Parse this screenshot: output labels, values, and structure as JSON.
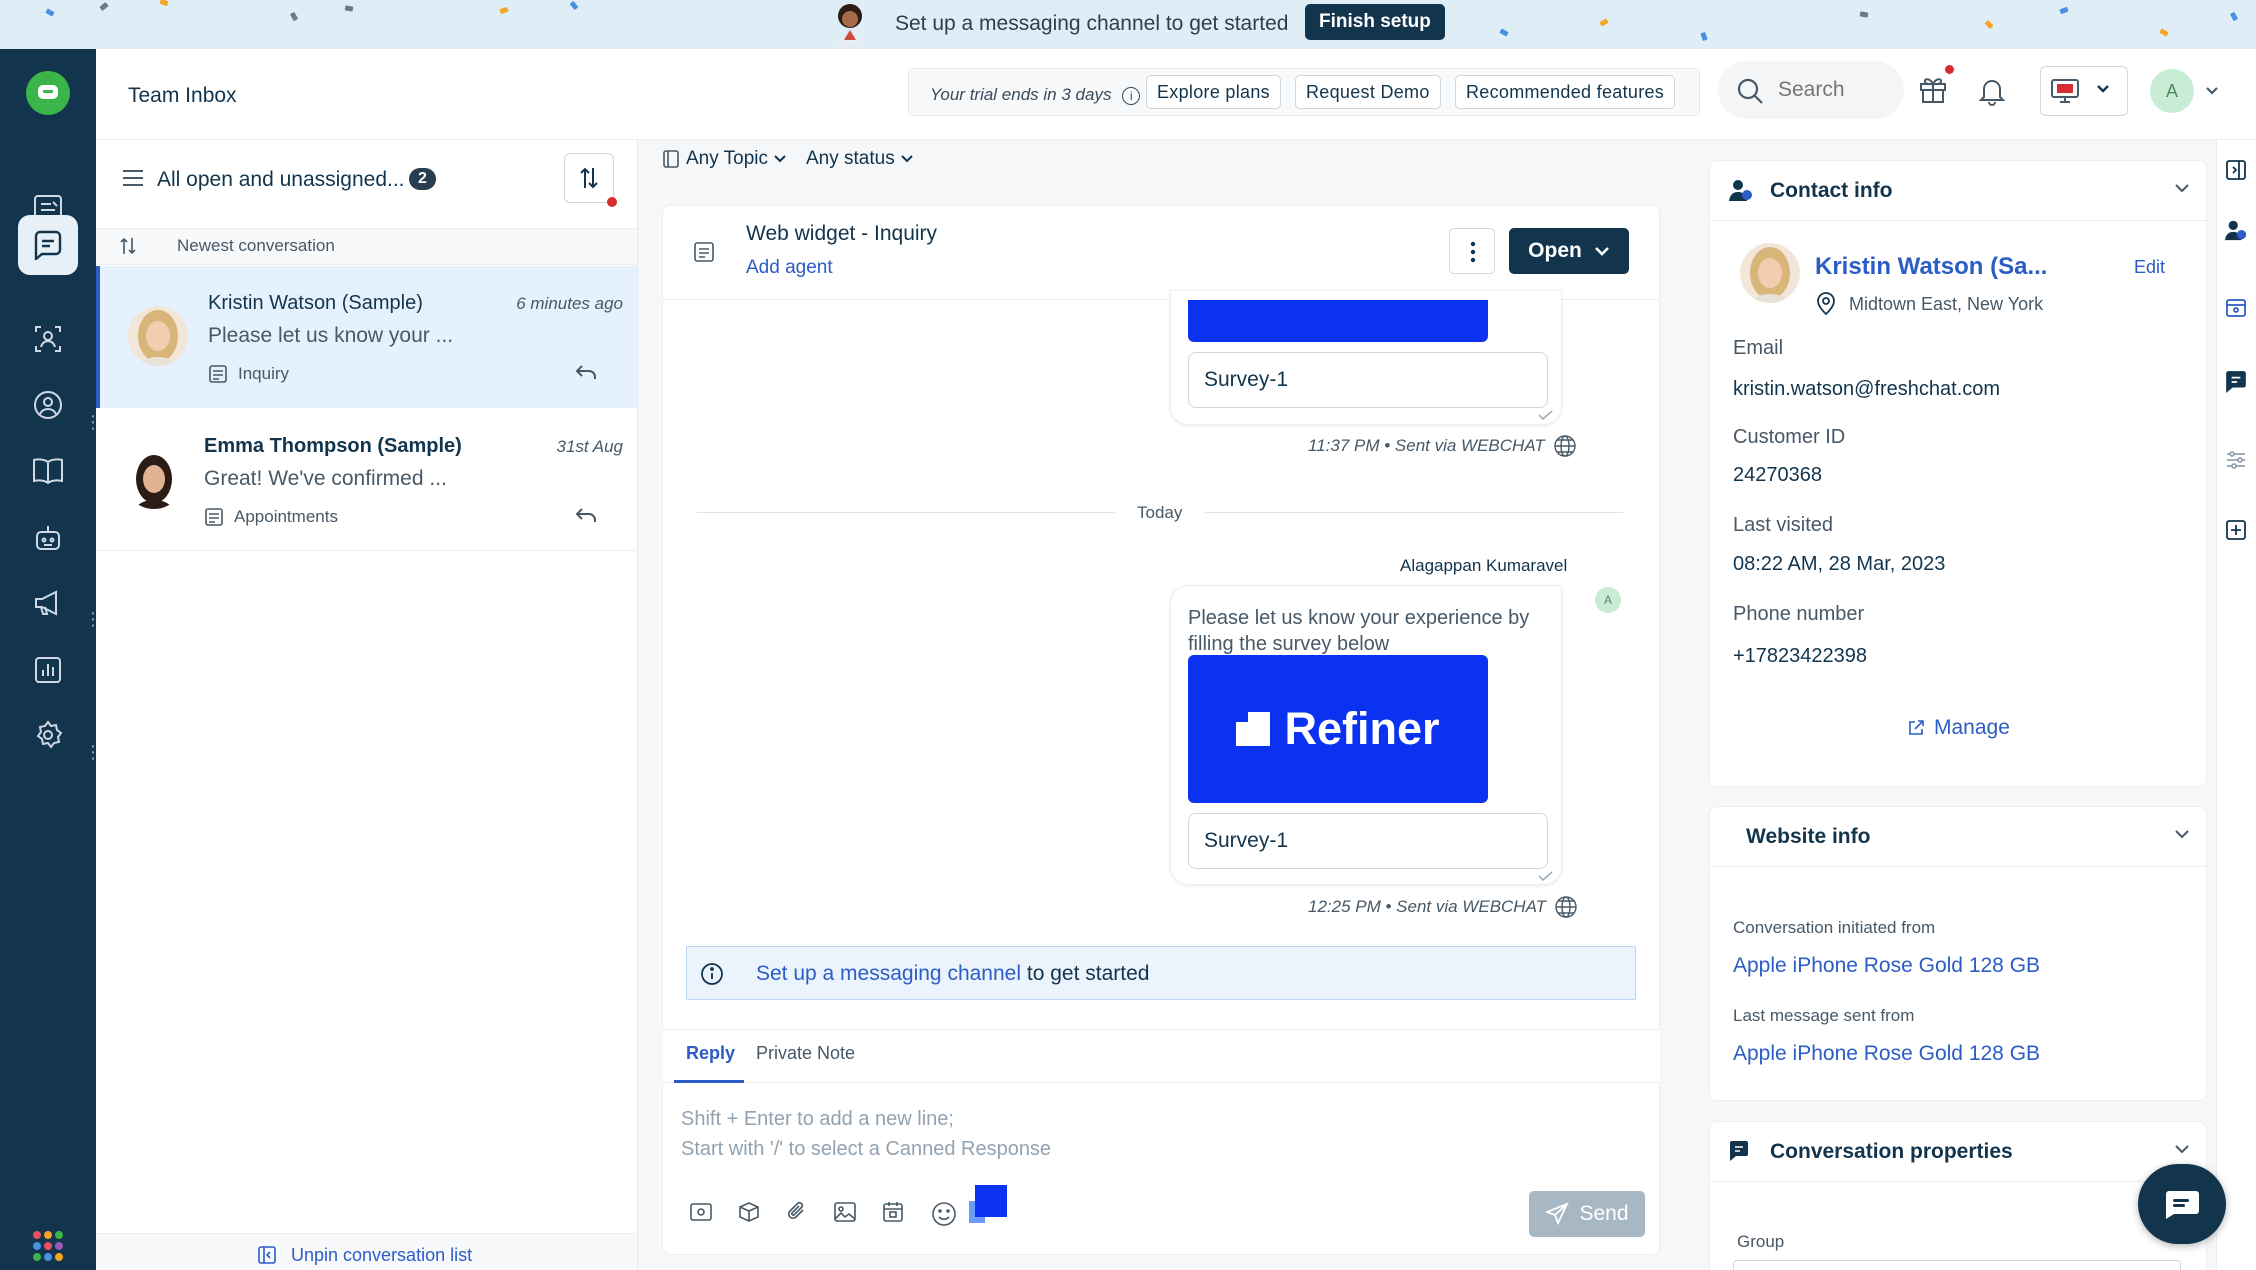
{
  "banner": {
    "text": "Set up a messaging channel to get started",
    "button": "Finish setup"
  },
  "header": {
    "title": "Team Inbox",
    "trial_text": "Your trial ends in 3 days",
    "buttons": [
      "Explore plans",
      "Request Demo",
      "Recommended features"
    ],
    "search_placeholder": "Search",
    "avatar_initial": "A"
  },
  "conv_list": {
    "title": "All open and unassigned...",
    "count": "2",
    "sort_label": "Newest conversation",
    "items": [
      {
        "name": "Kristin Watson (Sample)",
        "time": "6 minutes ago",
        "preview": "Please let us know your ...",
        "tag": "Inquiry",
        "active": true
      },
      {
        "name": "Emma Thompson (Sample)",
        "time": "31st Aug",
        "preview": "Great! We've confirmed ...",
        "tag": "Appointments",
        "active": false
      }
    ],
    "unpin_label": "Unpin conversation list"
  },
  "center": {
    "filters": {
      "topic": "Any Topic",
      "status": "Any status"
    },
    "conversation_title": "Web widget - Inquiry",
    "add_agent": "Add agent",
    "status_button": "Open",
    "messages": [
      {
        "survey_label": "Survey-1",
        "meta": "11:37 PM • Sent via WEBCHAT"
      },
      {
        "agent": "Alagappan Kumaravel",
        "agent_initial": "A",
        "text": "Please let us know your experience by filling the survey below",
        "card_brand": "Refiner",
        "survey_label": "Survey-1",
        "meta": "12:25 PM • Sent via WEBCHAT"
      }
    ],
    "date_divider": "Today",
    "setup_strip": {
      "link": "Set up a messaging channel",
      "rest": "to get started"
    },
    "compose": {
      "tabs": [
        "Reply",
        "Private Note"
      ],
      "placeholder_line1": "Shift + Enter to add a new line;",
      "placeholder_line2": "Start with '/' to select a Canned Response",
      "send": "Send"
    }
  },
  "contact": {
    "section_title": "Contact info",
    "name": "Kristin Watson (Sa...",
    "edit": "Edit",
    "location": "Midtown East, New York",
    "fields": [
      {
        "label": "Email",
        "value": "kristin.watson@freshchat.com"
      },
      {
        "label": "Customer ID",
        "value": "24270368"
      },
      {
        "label": "Last visited",
        "value": "08:22 AM, 28 Mar, 2023"
      },
      {
        "label": "Phone number",
        "value": "+17823422398"
      }
    ],
    "manage": "Manage"
  },
  "website_info": {
    "section_title": "Website info",
    "initiated_label": "Conversation initiated from",
    "initiated_value": "Apple iPhone Rose Gold 128 GB",
    "last_label": "Last message sent from",
    "last_value": "Apple iPhone Rose Gold 128 GB"
  },
  "conversation_properties": {
    "section_title": "Conversation properties",
    "group_label": "Group"
  },
  "colors": {
    "rail": "#12344d",
    "link": "#2c5cc5",
    "refiner_blue": "#0a32f0",
    "active_row": "#e5f2fd"
  }
}
